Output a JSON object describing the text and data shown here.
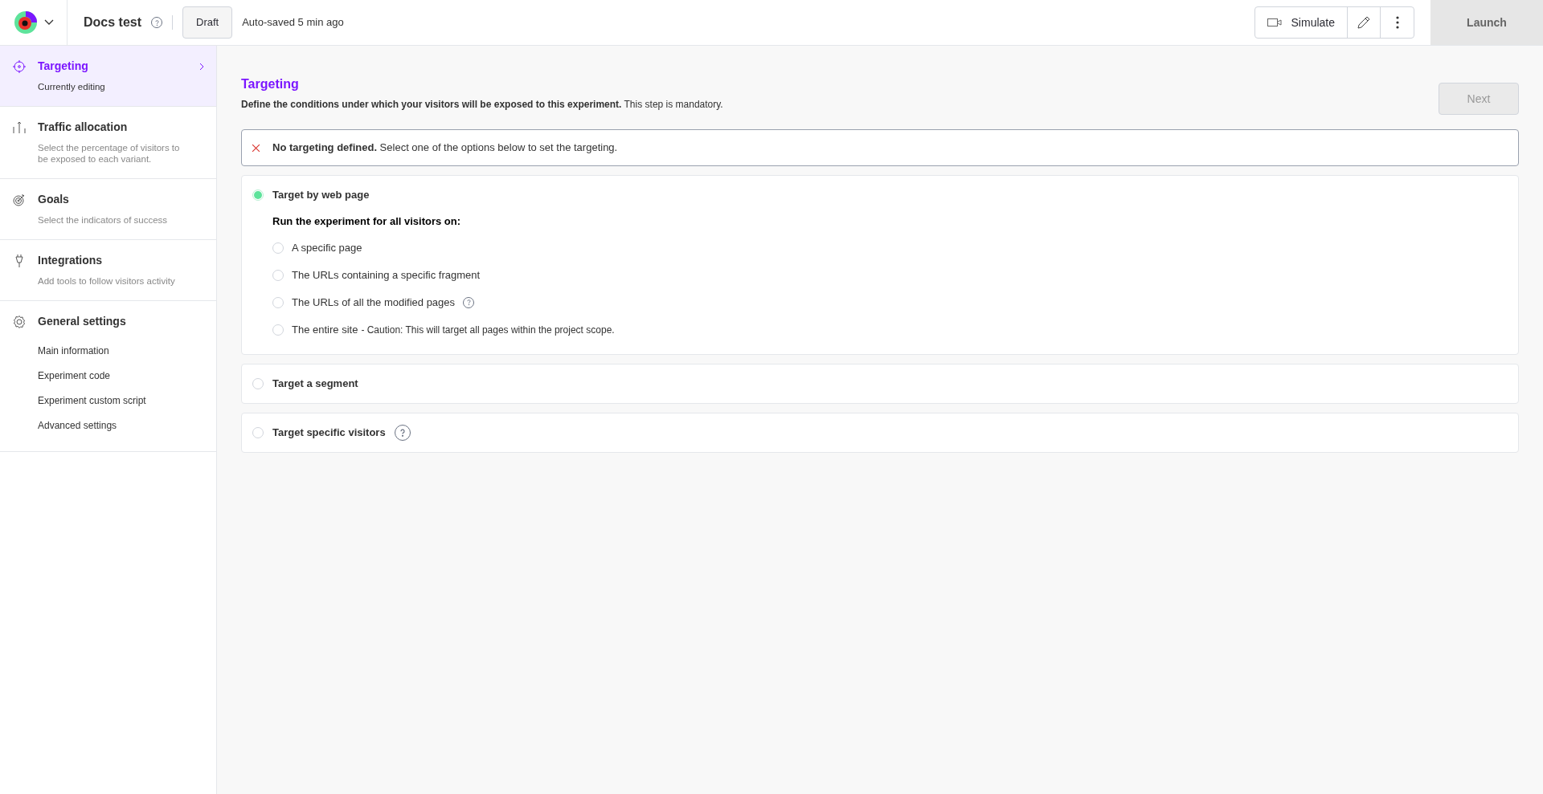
{
  "header": {
    "title": "Docs test",
    "status": "Draft",
    "autosave": "Auto-saved 5 min ago",
    "simulate": "Simulate",
    "launch": "Launch"
  },
  "sidebar": {
    "items": [
      {
        "kind": "target",
        "title": "Targeting",
        "subtitle": "Currently editing",
        "selected": true
      },
      {
        "kind": "traffic",
        "title": "Traffic allocation",
        "subtitle": "Select the percentage of visitors to be exposed to each variant.",
        "selected": false
      },
      {
        "kind": "goals",
        "title": "Goals",
        "subtitle": "Select the indicators of success",
        "selected": false
      },
      {
        "kind": "plug",
        "title": "Integrations",
        "subtitle": "Add tools to follow visitors activity",
        "selected": false
      },
      {
        "kind": "gear",
        "title": "General settings",
        "selected": false,
        "children": [
          "Main information",
          "Experiment code",
          "Experiment custom script",
          "Advanced settings"
        ]
      }
    ]
  },
  "main": {
    "title": "Targeting",
    "description": "**Define the conditions under which your visitors will be exposed to this experiment.** This step is mandatory.",
    "next": "Next",
    "alert": "**No targeting defined.** Select one of the options below to set the targeting.",
    "sections": [
      {
        "label": "Target by web page",
        "selected": true,
        "help": false,
        "prompt": "Run the experiment for all visitors on:",
        "options": [
          {
            "label": "A specific page",
            "selected": false,
            "help": false
          },
          {
            "label": "The URLs containing a specific fragment",
            "selected": false,
            "help": false
          },
          {
            "label": "The URLs of all the modified pages",
            "selected": false,
            "help": true
          },
          {
            "label": "The entire site",
            "note": "- Caution: This will target all pages within the project scope.",
            "selected": false,
            "help": false
          }
        ]
      },
      {
        "label": "Target a segment",
        "selected": false,
        "help": false
      },
      {
        "label": "Target specific visitors",
        "selected": false,
        "help": true
      }
    ]
  }
}
